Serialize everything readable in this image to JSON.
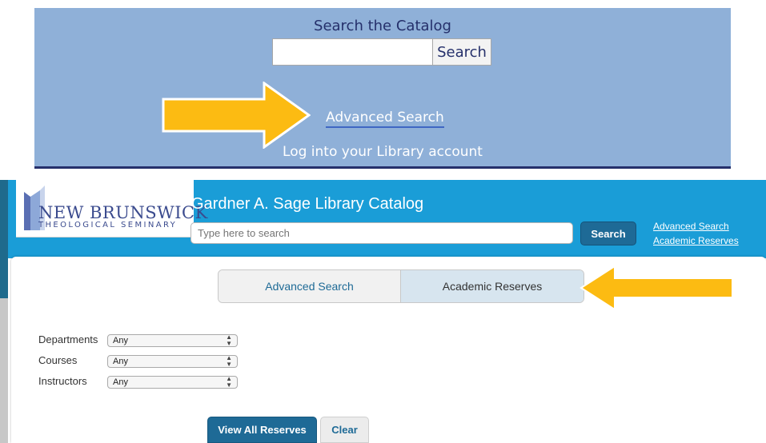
{
  "top_panel": {
    "title": "Search the Catalog",
    "search_value": "",
    "search_button": "Search",
    "advanced_search_link": "Advanced Search",
    "login_link": "Log into your Library account"
  },
  "catalog": {
    "logo_line1": "NEW BRUNSWICK",
    "logo_line2": "THEOLOGICAL SEMINARY",
    "title": "Gardner A. Sage Library Catalog",
    "search_placeholder": "Type here to search",
    "search_button": "Search",
    "advanced_search_link": "Advanced Search",
    "academic_reserves_link": "Academic Reserves"
  },
  "tabs": [
    {
      "label": "Advanced Search",
      "active": false
    },
    {
      "label": "Academic Reserves",
      "active": true
    }
  ],
  "filters": [
    {
      "label": "Departments",
      "value": "Any"
    },
    {
      "label": "Courses",
      "value": "Any"
    },
    {
      "label": "Instructors",
      "value": "Any"
    }
  ],
  "buttons": {
    "view_all": "View All Reserves",
    "clear": "Clear"
  },
  "colors": {
    "panel_blue": "#8fb0d8",
    "header_blue": "#1a9dd7",
    "button_blue": "#1e6a96",
    "arrow_yellow": "#fcbb12"
  }
}
